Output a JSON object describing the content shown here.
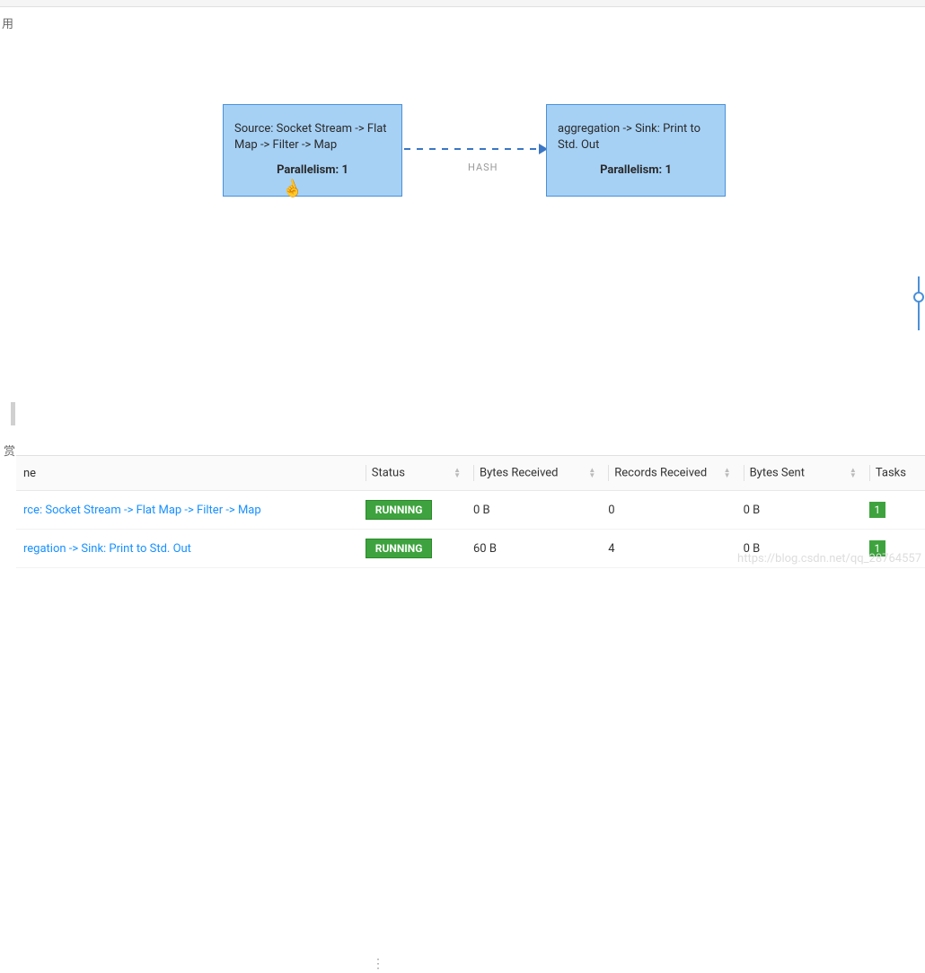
{
  "sidebar": {
    "char_top": "用",
    "char_bottom": "赏"
  },
  "graph": {
    "node1": {
      "label": "Source: Socket Stream -> Flat Map -> Filter -> Map",
      "parallelism": "Parallelism: 1"
    },
    "node2": {
      "label": "aggregation -> Sink: Print to Std. Out",
      "parallelism": "Parallelism: 1"
    },
    "edge_label": "HASH"
  },
  "table": {
    "headers": {
      "name": "ne",
      "status": "Status",
      "bytes_received": "Bytes Received",
      "records_received": "Records Received",
      "bytes_sent": "Bytes Sent",
      "tasks": "Tasks"
    },
    "rows": [
      {
        "name": "rce: Socket Stream -> Flat Map -> Filter -> Map",
        "status": "RUNNING",
        "bytes_received": "0 B",
        "records_received": "0",
        "bytes_sent": "0 B",
        "tasks": "1"
      },
      {
        "name": "regation -> Sink: Print to Std. Out",
        "status": "RUNNING",
        "bytes_received": "60 B",
        "records_received": "4",
        "bytes_sent": "0 B",
        "tasks": "1"
      }
    ]
  },
  "watermark": "https://blog.csdn.net/qq_28764557"
}
